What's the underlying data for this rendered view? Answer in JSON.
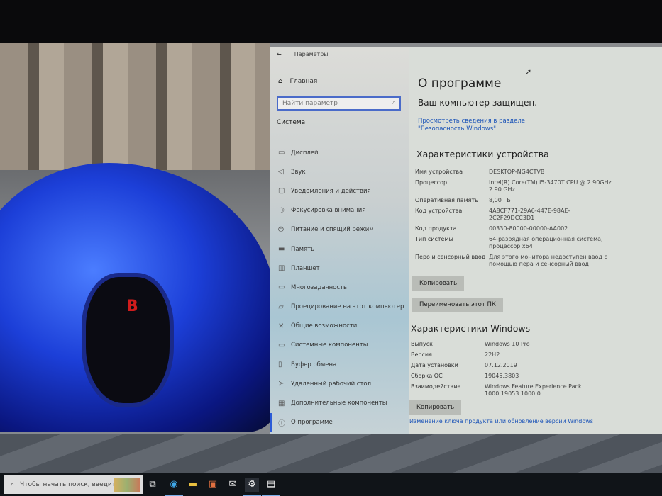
{
  "window": {
    "title": "Параметры"
  },
  "sidebar": {
    "home": "Главная",
    "search_placeholder": "Найти параметр",
    "section": "Система",
    "items": [
      {
        "label": "Дисплей",
        "icon": "monitor-icon"
      },
      {
        "label": "Звук",
        "icon": "speaker-icon"
      },
      {
        "label": "Уведомления и действия",
        "icon": "notification-icon"
      },
      {
        "label": "Фокусировка внимания",
        "icon": "moon-icon"
      },
      {
        "label": "Питание и спящий режим",
        "icon": "power-icon"
      },
      {
        "label": "Память",
        "icon": "storage-icon"
      },
      {
        "label": "Планшет",
        "icon": "tablet-icon"
      },
      {
        "label": "Многозадачность",
        "icon": "multitask-icon"
      },
      {
        "label": "Проецирование на этот компьютер",
        "icon": "project-icon"
      },
      {
        "label": "Общие возможности",
        "icon": "shared-icon"
      },
      {
        "label": "Системные компоненты",
        "icon": "components-icon"
      },
      {
        "label": "Буфер обмена",
        "icon": "clipboard-icon"
      },
      {
        "label": "Удаленный рабочий стол",
        "icon": "remote-icon"
      },
      {
        "label": "Дополнительные компоненты",
        "icon": "optional-icon"
      },
      {
        "label": "О программе",
        "icon": "info-icon"
      }
    ]
  },
  "main": {
    "title": "О программе",
    "protected": "Ваш компьютер защищен.",
    "security_link": "Просмотреть сведения в разделе \"Безопасность Windows\"",
    "device_heading": "Характеристики устройства",
    "device_specs": [
      {
        "k": "Имя устройства",
        "v": "DESKTOP-NG4CTVB"
      },
      {
        "k": "Процессор",
        "v": "Intel(R) Core(TM) i5-3470T CPU @ 2.90GHz 2.90 GHz"
      },
      {
        "k": "Оперативная память",
        "v": "8,00 ГБ"
      },
      {
        "k": "Код устройства",
        "v": "4A8CF771-29A6-447E-98AE-2C2F29DCC3D1"
      },
      {
        "k": "Код продукта",
        "v": "00330-80000-00000-AA002"
      },
      {
        "k": "Тип системы",
        "v": "64-разрядная операционная система, процессор x64"
      },
      {
        "k": "Перо и сенсорный ввод",
        "v": "Для этого монитора недоступен ввод с помощью пера и сенсорный ввод"
      }
    ],
    "copy_button": "Копировать",
    "rename_button": "Переименовать этот ПК",
    "windows_heading": "Характеристики Windows",
    "windows_specs": [
      {
        "k": "Выпуск",
        "v": "Windows 10 Pro"
      },
      {
        "k": "Версия",
        "v": "22H2"
      },
      {
        "k": "Дата установки",
        "v": "07.12.2019"
      },
      {
        "k": "Сборка ОС",
        "v": "19045.3803"
      },
      {
        "k": "Взаимодействие",
        "v": "Windows Feature Experience Pack 1000.19053.1000.0"
      }
    ],
    "copy_button2": "Копировать",
    "change_key_link": "Изменение ключа продукта или обновление версии Windows"
  },
  "taskbar": {
    "search_placeholder": "Чтобы начать поиск, введите"
  }
}
